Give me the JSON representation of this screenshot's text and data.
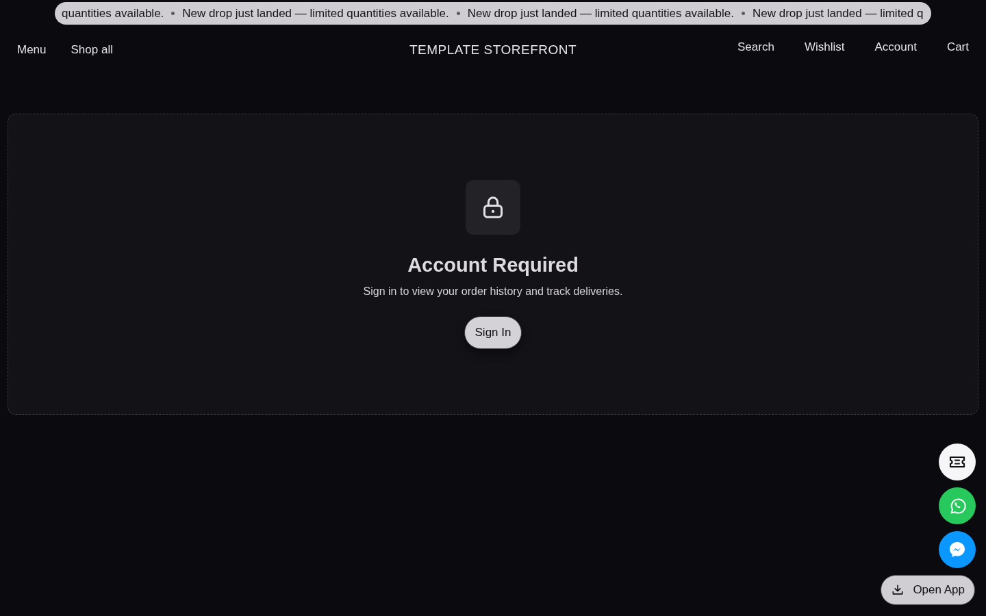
{
  "announcement_bar": {
    "messages": [
      "quantities available.",
      "New drop just landed — limited quantities available.",
      "New drop just landed — limited quantities available.",
      "New drop just landed — limited q"
    ]
  },
  "header": {
    "left_links": [
      "Menu",
      "Shop all"
    ],
    "logo": "TEMPLATE STOREFRONT",
    "right_links": [
      "Search",
      "Wishlist",
      "Account",
      "Cart"
    ]
  },
  "account_gate": {
    "title": "Account Required",
    "message": "Sign in to view your order history and track deliveries.",
    "button": "Sign In"
  },
  "floating_actions": {
    "app_button": "Open App"
  }
}
